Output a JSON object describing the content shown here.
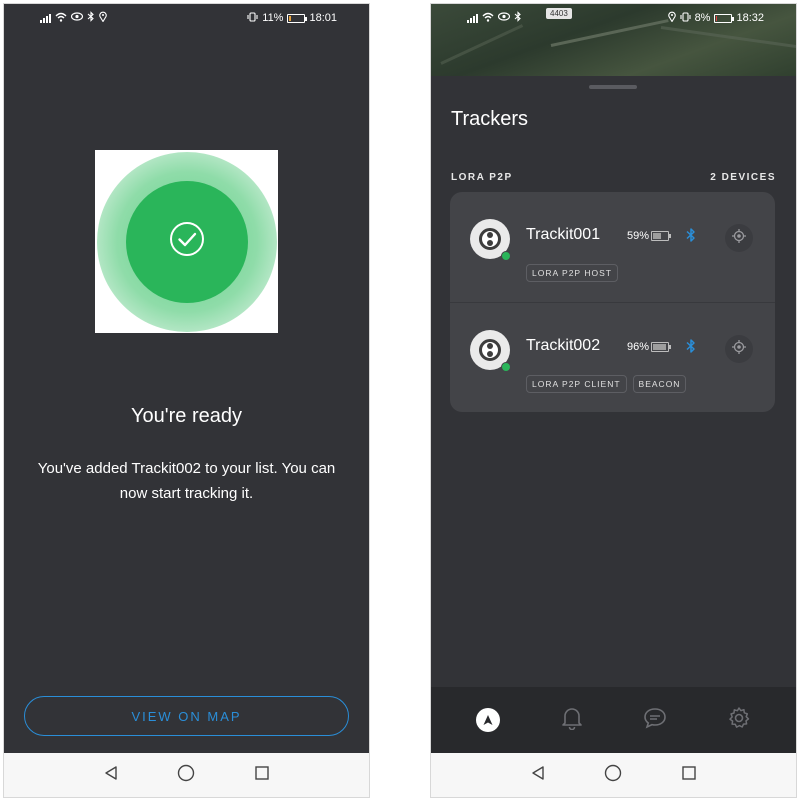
{
  "left": {
    "status": {
      "time": "18:01",
      "battery": "11%",
      "battery_level": 0.11
    },
    "title": "You're ready",
    "message": "You've added Trackit002 to your list. You can now start tracking it.",
    "view_button": "VIEW ON MAP"
  },
  "right": {
    "status": {
      "time": "18:32",
      "battery": "8%",
      "battery_level": 0.08
    },
    "map_badge": "4403",
    "title": "Trackers",
    "section_label": "LORA P2P",
    "section_count": "2 DEVICES",
    "devices": [
      {
        "name": "Trackit001",
        "battery": "59%",
        "battery_level": 0.59,
        "tags": [
          "LORA P2P HOST"
        ]
      },
      {
        "name": "Trackit002",
        "battery": "96%",
        "battery_level": 0.96,
        "tags": [
          "LORA P2P CLIENT",
          "BEACON"
        ]
      }
    ],
    "tabs": [
      "navigate-icon",
      "bell-icon",
      "chat-icon",
      "gear-icon"
    ]
  },
  "colors": {
    "accent": "#2a8ed8",
    "success": "#2ab55a",
    "background": "#323337",
    "card": "#434448",
    "battery_low": "#e8a23a"
  }
}
